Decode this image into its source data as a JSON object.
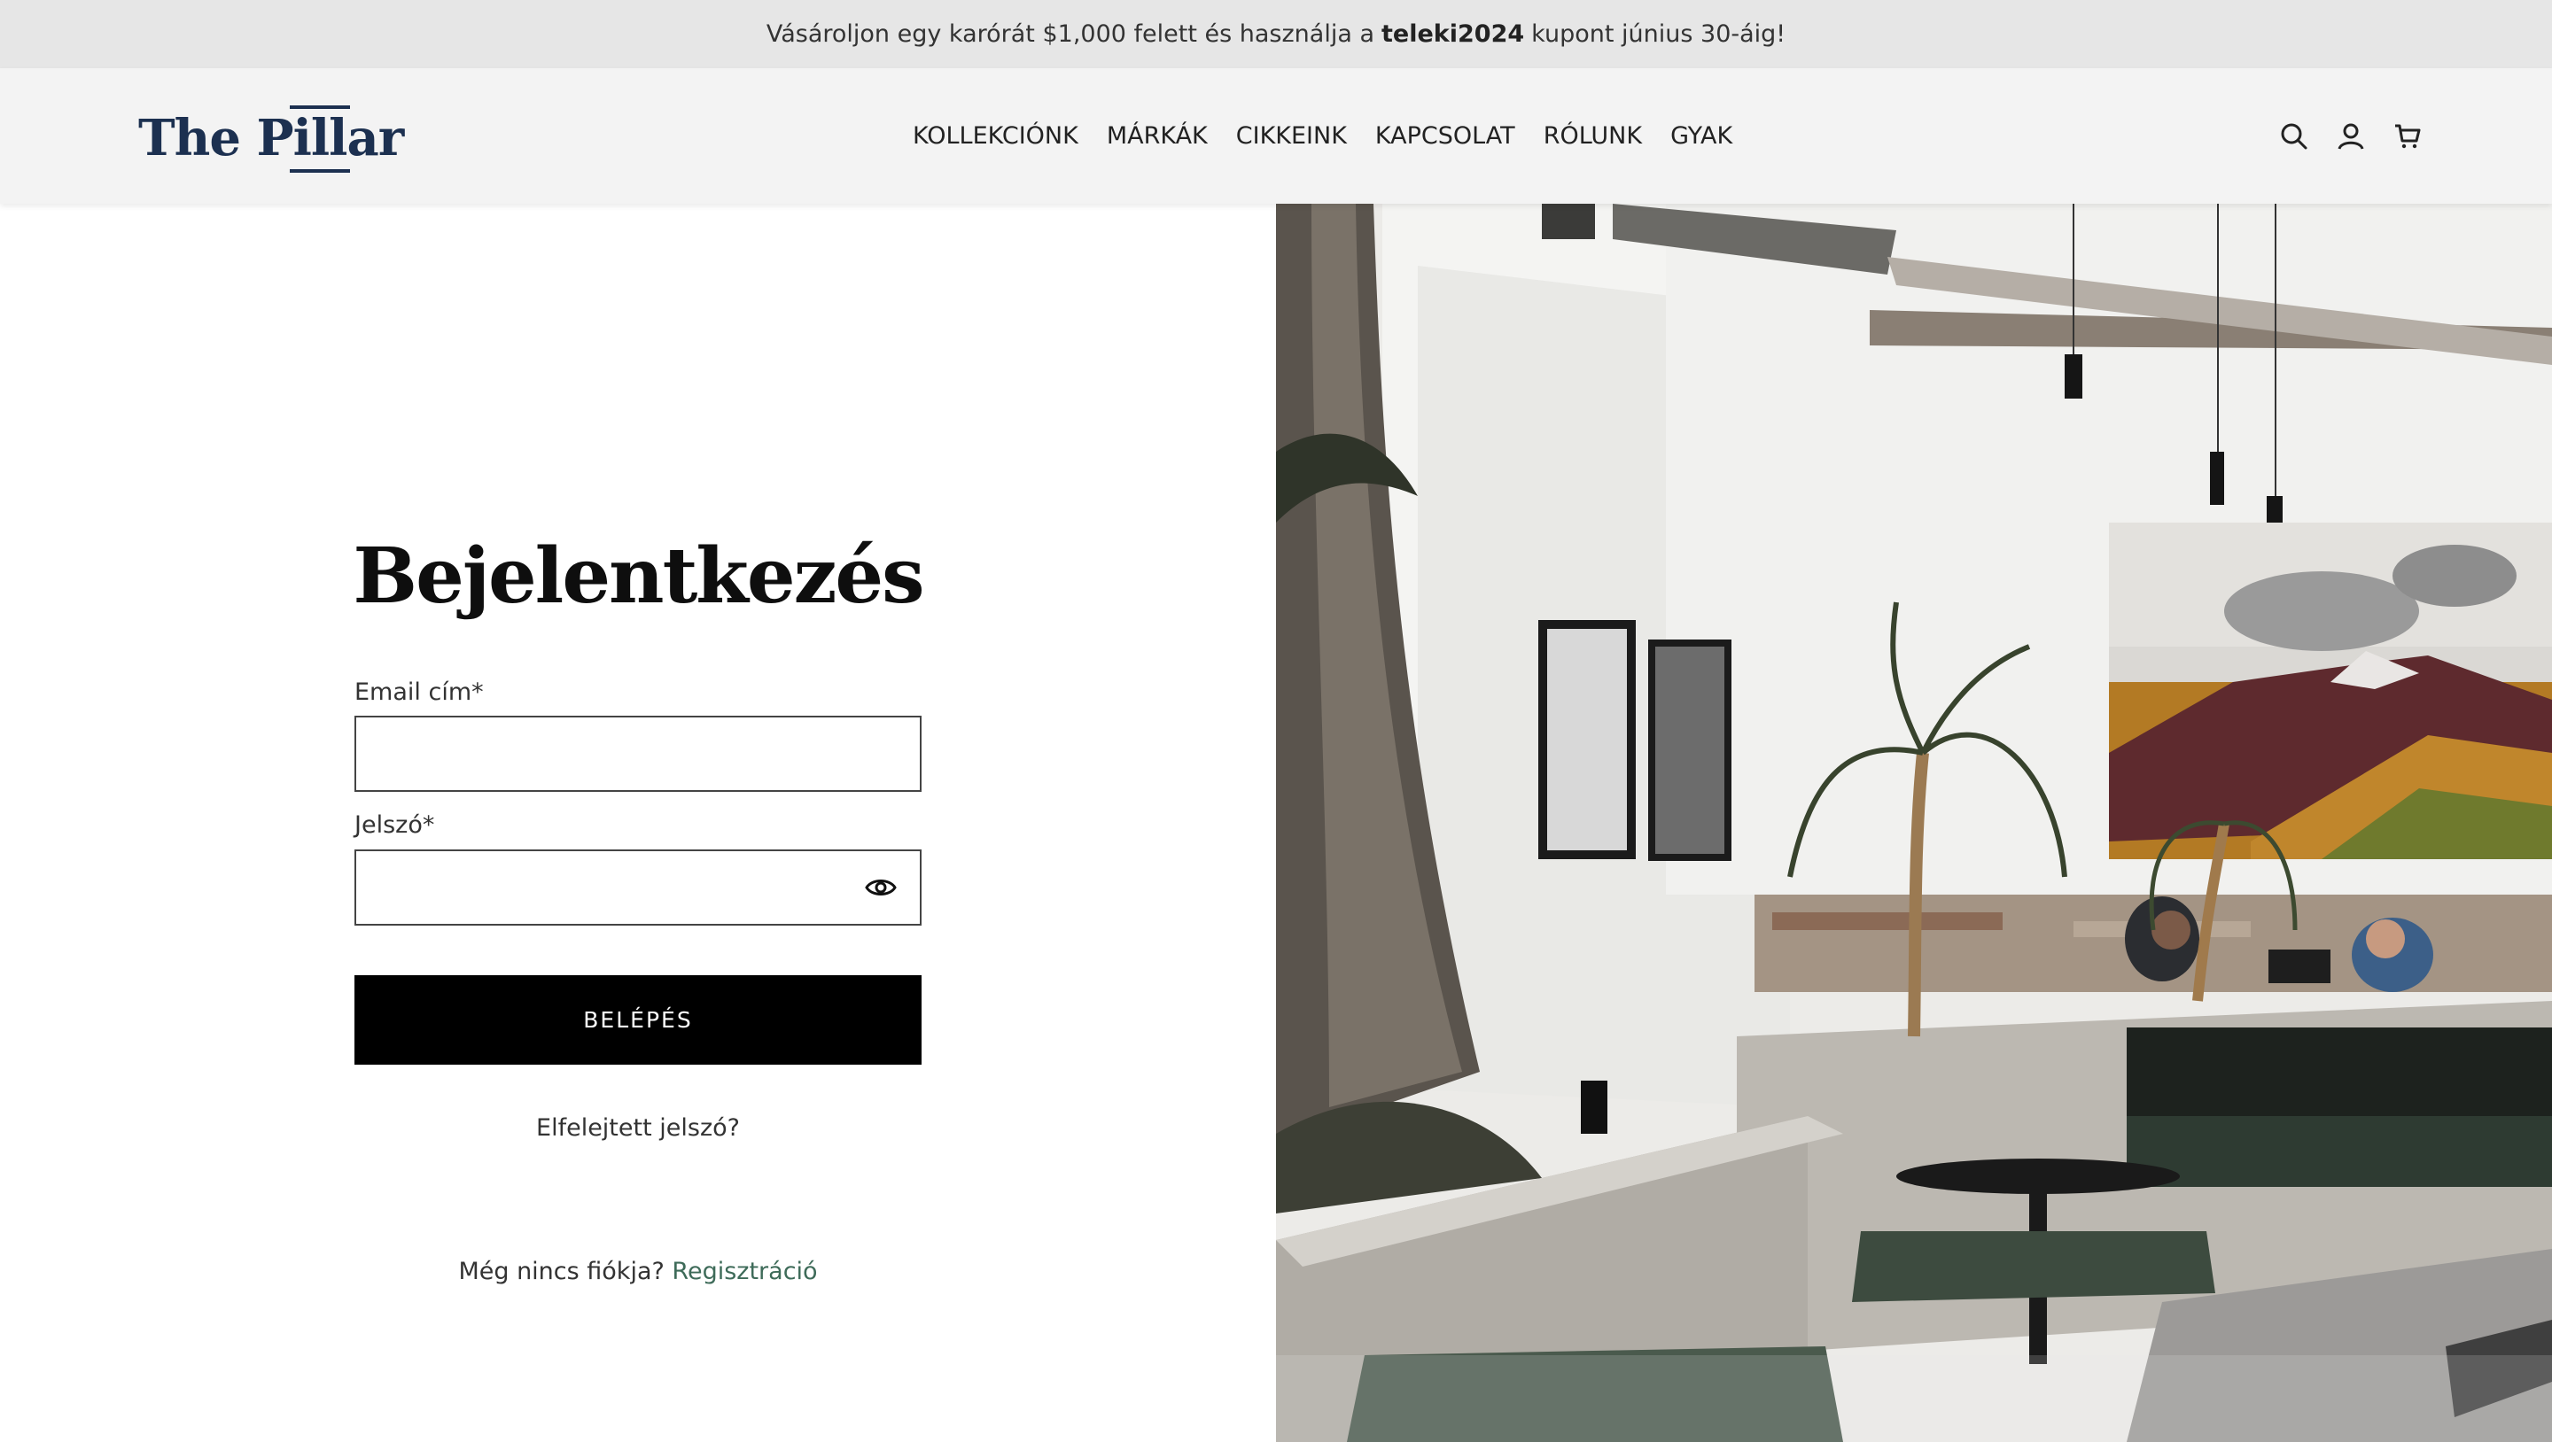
{
  "announcement": {
    "before": "Vásároljon egy karórát $1,000 felett és használja a",
    "code": "teleki2024",
    "after": "kupont június 30-áig!"
  },
  "header": {
    "logo_prefix": "The P",
    "logo_pillar": "ill",
    "logo_suffix": "ar",
    "nav": [
      "KOLLEKCIÓNK",
      "MÁRKÁK",
      "CIKKEINK",
      "KAPCSOLAT",
      "RÓLUNK",
      "GYAK"
    ],
    "icons": [
      "search-icon",
      "account-icon",
      "cart-icon"
    ]
  },
  "login": {
    "title": "Bejelentkezés",
    "email_label": "Email cím*",
    "email_value": "",
    "password_label": "Jelszó*",
    "password_value": "",
    "submit_label": "BELÉPÉS",
    "forgot_label": "Elfelejtett jelszó?",
    "no_account_text": "Még nincs fiókja?",
    "register_label": "Regisztráció"
  },
  "colors": {
    "brand": "#1c3050",
    "link": "#3e6b59",
    "button": "#000000",
    "announcement_bg": "#e6e6e6",
    "header_bg": "#f3f3f3"
  }
}
